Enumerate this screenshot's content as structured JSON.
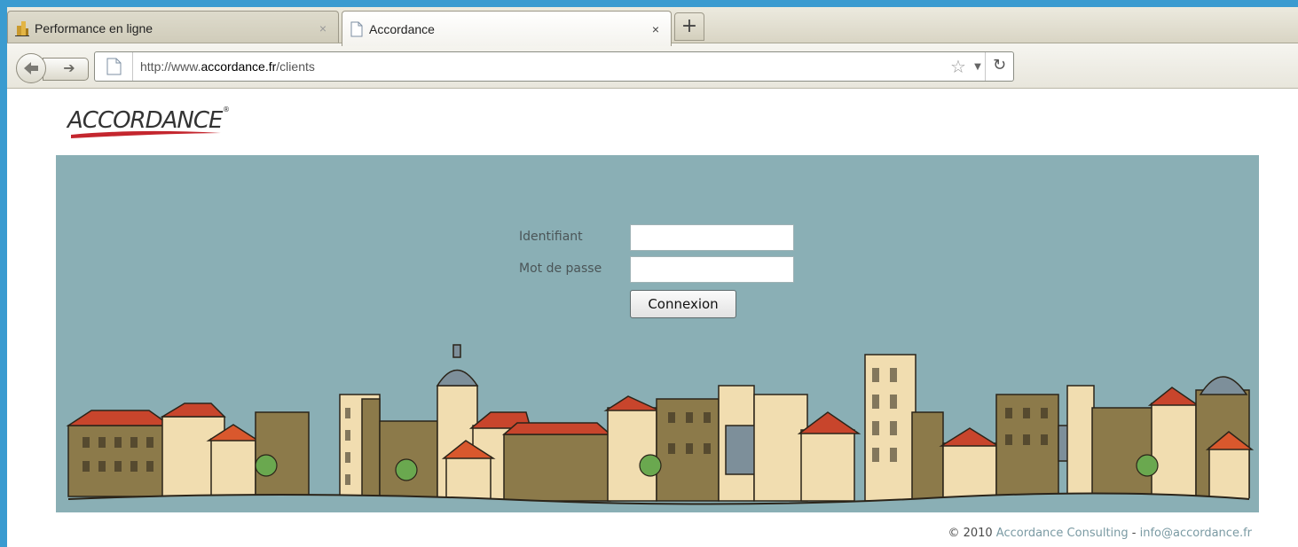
{
  "browser": {
    "tabs": [
      {
        "label": "Performance en ligne",
        "active": false
      },
      {
        "label": "Accordance",
        "active": true
      }
    ],
    "new_tab_symbol": "+",
    "close_symbol": "×",
    "url_prefix": "http://www.",
    "url_domain": "accordance.fr",
    "url_path": "/clients",
    "icons": {
      "back": "back-arrow-icon",
      "forward": "forward-arrow-icon",
      "bookmark": "star-icon",
      "reload": "reload-icon"
    }
  },
  "page": {
    "logo_text": "ACCORDANCE",
    "logo_mark": "®",
    "login": {
      "username_label": "Identifiant",
      "username_value": "",
      "password_label": "Mot de passe",
      "password_value": "",
      "submit_label": "Connexion"
    },
    "footer": {
      "copyright": "© 2010",
      "company": "Accordance Consulting",
      "separator": " - ",
      "email": "info@accordance.fr"
    },
    "colors": {
      "banner": "#8aafb5",
      "logo_red": "#c4262e",
      "building_tan": "#8c7a4a",
      "building_cream": "#f1ddb0",
      "roof_red": "#c8452c"
    }
  }
}
